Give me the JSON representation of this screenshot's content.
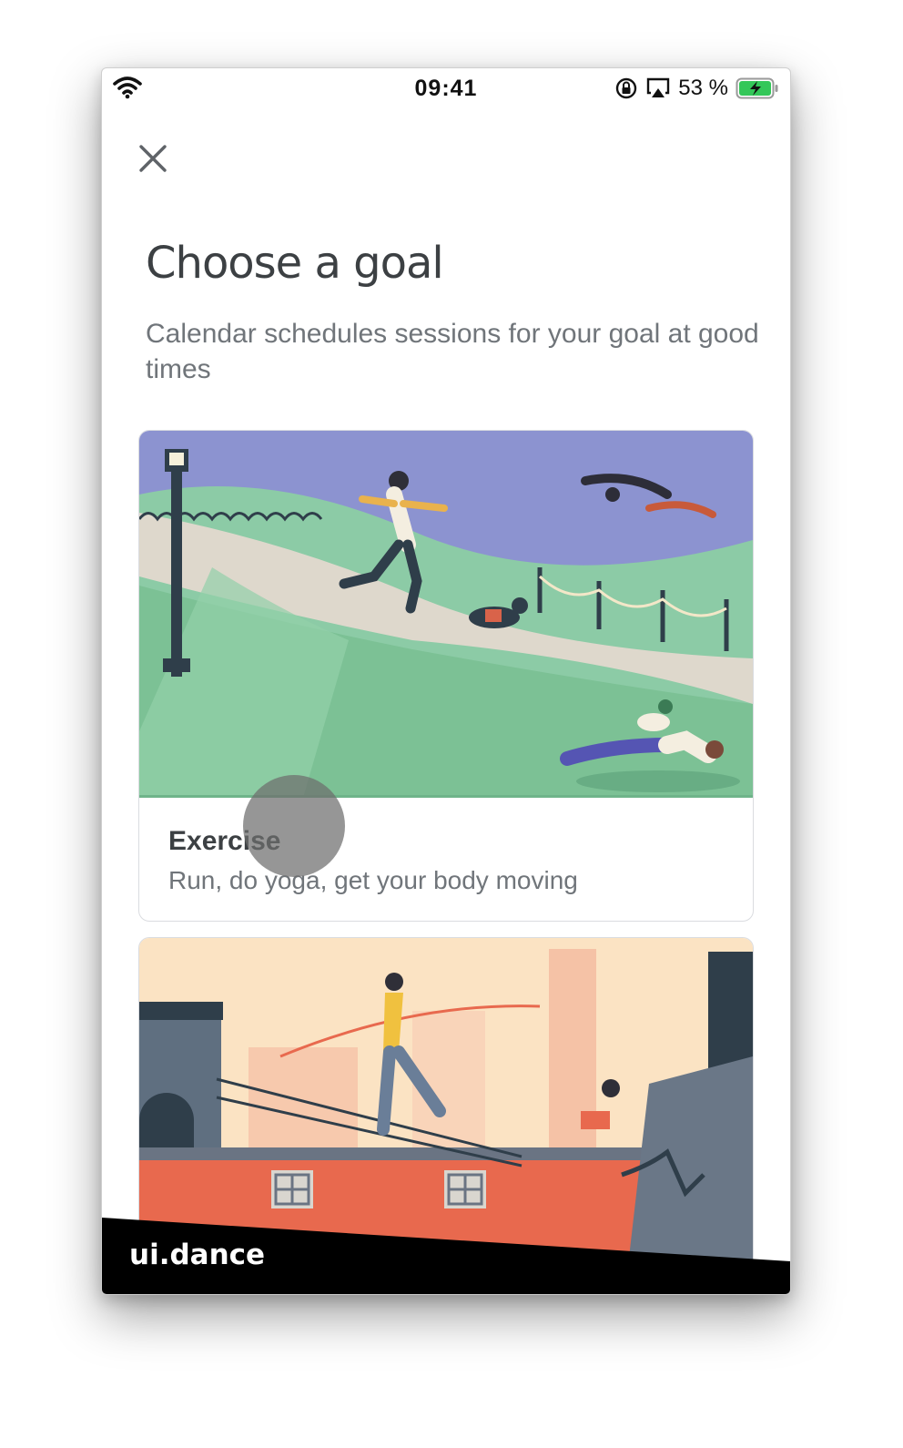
{
  "status_bar": {
    "time": "09:41",
    "battery_percent": "53 %",
    "icons": [
      "wifi-icon",
      "rotation-lock-icon",
      "airplay-icon",
      "battery-charging-icon"
    ]
  },
  "header": {
    "close_icon": "close-icon"
  },
  "page": {
    "title": "Choose a goal",
    "subtitle": "Calendar schedules sessions for your goal at good times"
  },
  "goals": [
    {
      "title": "Exercise",
      "description": "Run, do yoga, get your body moving",
      "illustration": "park-exercise-illustration"
    },
    {
      "title": "",
      "description": "",
      "illustration": "rooftop-city-illustration"
    }
  ],
  "watermark": "ui.dance",
  "colors": {
    "title": "#3c4043",
    "secondary_text": "#70757a",
    "card_border": "#dadce0",
    "battery_green": "#34c759"
  }
}
